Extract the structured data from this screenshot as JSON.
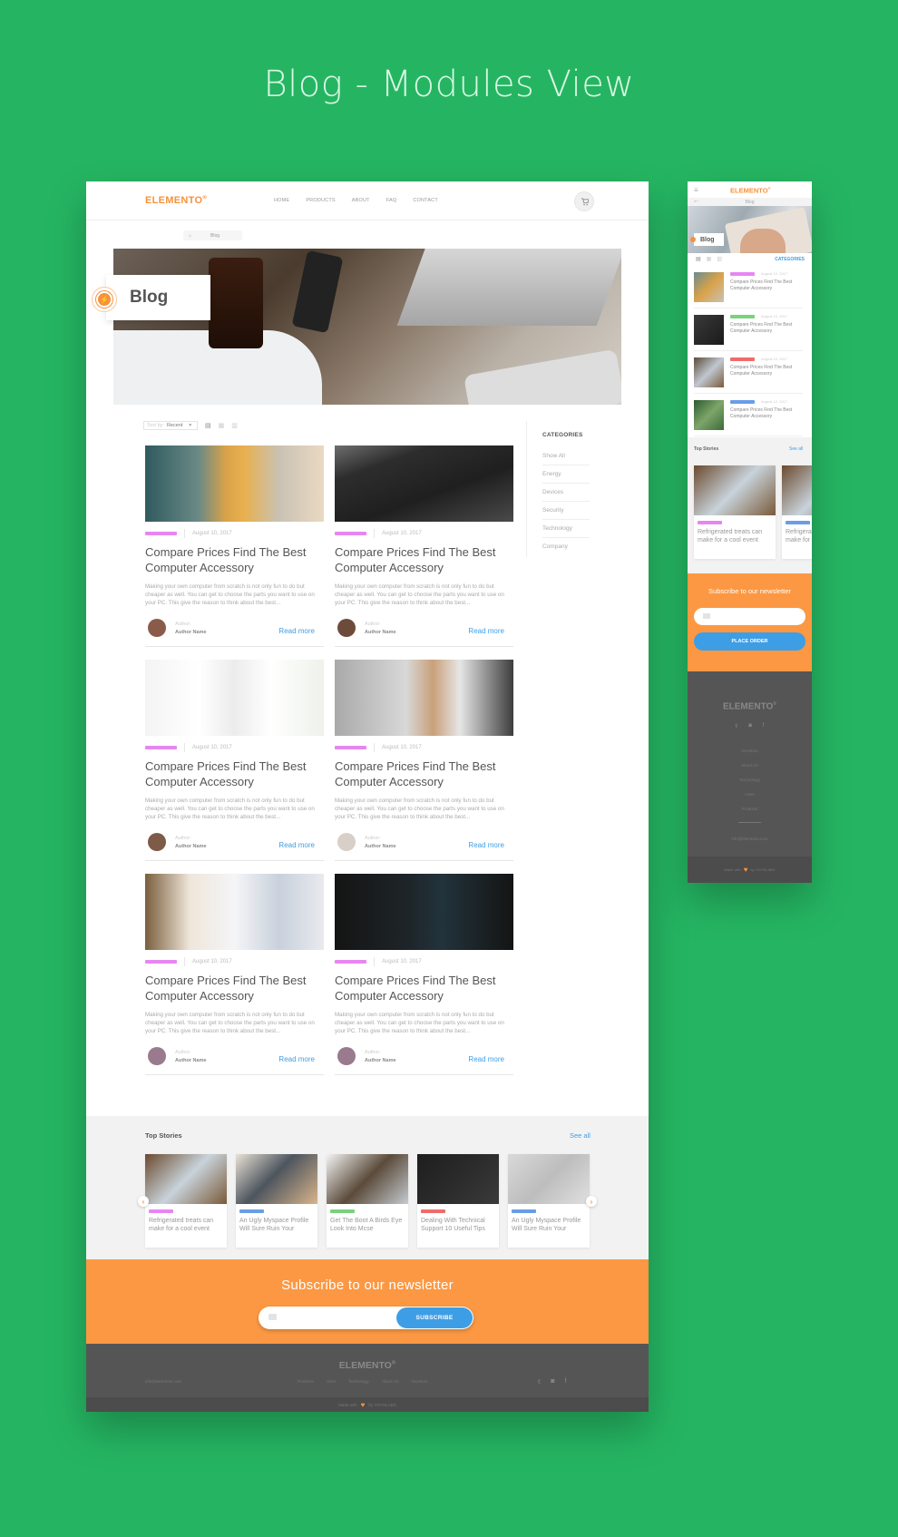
{
  "page_title": "Blog - Modules View",
  "colors": {
    "background": "#25b562",
    "brand_orange": "#f7923a",
    "newsletter_orange": "#fc9843",
    "link_blue": "#3d9ee6",
    "footer_dark": "#555555",
    "tag_pink": "#e786f2",
    "tag_green": "#7bd17e",
    "tag_red": "#ef6b6b",
    "tag_blue": "#6a9de6"
  },
  "desktop": {
    "logo": "ELEMENTO",
    "logo_mark": "®",
    "nav": [
      "HOME",
      "PRODUCTS",
      "ABOUT",
      "FAQ",
      "CONTACT"
    ],
    "cart_icon": "cart-icon",
    "breadcrumb": {
      "home_icon": "⌂",
      "current": "Blog"
    },
    "hero_title": "Blog",
    "hero_badge_icon": "⚡",
    "sort": {
      "label": "Sort by:",
      "value": "Recent",
      "caret": "▾"
    },
    "view_icons": [
      "▤",
      "▦",
      "▥"
    ],
    "categories": {
      "title": "CATEGORIES",
      "items": [
        "Show All",
        "Energy",
        "Devices",
        "Security",
        "Technology",
        "Company"
      ]
    },
    "posts": [
      {
        "tag_color": "#e786f2",
        "date": "August 10, 2017",
        "title": "Compare Prices Find The Best Computer Accessory",
        "excerpt": "Making your own computer from scratch is not only fun to do but cheaper as well. You can get to choose the parts you want to use on your PC. This give the reason to think about the best...",
        "author_label": "Author:",
        "author_name": "Author Name",
        "read_more": "Read more"
      },
      {
        "tag_color": "#e786f2",
        "date": "August 10, 2017",
        "title": "Compare Prices Find The Best Computer Accessory",
        "excerpt": "Making your own computer from scratch is not only fun to do but cheaper as well. You can get to choose the parts you want to use on your PC. This give the reason to think about the best...",
        "author_label": "Author:",
        "author_name": "Author Name",
        "read_more": "Read more"
      },
      {
        "tag_color": "#e786f2",
        "date": "August 10, 2017",
        "title": "Compare Prices Find The Best Computer Accessory",
        "excerpt": "Making your own computer from scratch is not only fun to do but cheaper as well. You can get to choose the parts you want to use on your PC. This give the reason to think about the best...",
        "author_label": "Author:",
        "author_name": "Author Name",
        "read_more": "Read more"
      },
      {
        "tag_color": "#e786f2",
        "date": "August 10, 2017",
        "title": "Compare Prices Find The Best Computer Accessory",
        "excerpt": "Making your own computer from scratch is not only fun to do but cheaper as well. You can get to choose the parts you want to use on your PC. This give the reason to think about the best...",
        "author_label": "Author:",
        "author_name": "Author Name",
        "read_more": "Read more"
      },
      {
        "tag_color": "#e786f2",
        "date": "August 10, 2017",
        "title": "Compare Prices Find The Best Computer Accessory",
        "excerpt": "Making your own computer from scratch is not only fun to do but cheaper as well. You can get to choose the parts you want to use on your PC. This give the reason to think about the best...",
        "author_label": "Author:",
        "author_name": "Author Name",
        "read_more": "Read more"
      },
      {
        "tag_color": "#e786f2",
        "date": "August 10, 2017",
        "title": "Compare Prices Find The Best Computer Accessory",
        "excerpt": "Making your own computer from scratch is not only fun to do but cheaper as well. You can get to choose the parts you want to use on your PC. This give the reason to think about the best...",
        "author_label": "Author:",
        "author_name": "Author Name",
        "read_more": "Read more"
      }
    ],
    "top_stories": {
      "title": "Top Stories",
      "see_all": "See all",
      "prev_icon": "‹",
      "next_icon": "›",
      "items": [
        {
          "tag_color": "#e786f2",
          "text": "Refrigerated treats can make for a cool event"
        },
        {
          "tag_color": "#6a9de6",
          "text": "An Ugly Myspace Profile Will Sure Ruin Your"
        },
        {
          "tag_color": "#7bd17e",
          "text": "Get The Boot A Birds Eye Look Into Mcse"
        },
        {
          "tag_color": "#ef6b6b",
          "text": "Dealing With Technical Support 10 Useful Tips"
        },
        {
          "tag_color": "#6a9de6",
          "text": "An Ugly Myspace Profile Will Sure Ruin Your"
        }
      ]
    },
    "newsletter": {
      "title": "Subscribe to our newsletter",
      "placeholder": "",
      "button": "SUBSCRIBE"
    },
    "footer": {
      "logo": "ELEMENTO",
      "logo_mark": "®",
      "email": "info@elemento.com",
      "links": [
        "Products",
        "Uses",
        "Technology",
        "About Us",
        "Investors"
      ],
      "social": [
        "𝕥",
        "◙",
        "f"
      ],
      "made_with": "Made with",
      "by": "by YOYOLABS"
    }
  },
  "mobile": {
    "menu_icon": "≡",
    "logo": "ELEMENTO",
    "logo_mark": "®",
    "back_icon": "←",
    "breadcrumb": "Blog",
    "hero_title": "Blog",
    "view_icons": [
      "▤",
      "▦",
      "▥"
    ],
    "categories_link": "CATEGORIES",
    "list": [
      {
        "tag_color": "#e786f2",
        "date": "August 10, 2017",
        "title": "Compare Prices Find The Best Computer Accessory"
      },
      {
        "tag_color": "#7bd17e",
        "date": "August 10, 2017",
        "title": "Compare Prices Find The Best Computer Accessory"
      },
      {
        "tag_color": "#ef6b6b",
        "date": "August 10, 2017",
        "title": "Compare Prices Find The Best Computer Accessory"
      },
      {
        "tag_color": "#6a9de6",
        "date": "August 10, 2017",
        "title": "Compare Prices Find The Best Computer Accessory"
      }
    ],
    "top_stories": {
      "title": "Top Stories",
      "see_all": "See all",
      "items": [
        {
          "tag_color": "#e786f2",
          "text": "Refrigerated treats can make for a cool event"
        },
        {
          "tag_color": "#6a9de6",
          "text": "Refrigerated treats can make for a cool event"
        }
      ]
    },
    "newsletter": {
      "title": "Subscribe to our newsletter",
      "placeholder": "",
      "button": "PLACE ORDER"
    },
    "footer": {
      "logo": "ELEMENTO",
      "logo_mark": "®",
      "social": [
        "𝕥",
        "◙",
        "f"
      ],
      "links": [
        "Investors",
        "About Us",
        "Technology",
        "Uses",
        "Products"
      ],
      "email": "info@elemento.com",
      "made_with": "Made with",
      "by": "by YOYOLABS"
    }
  }
}
